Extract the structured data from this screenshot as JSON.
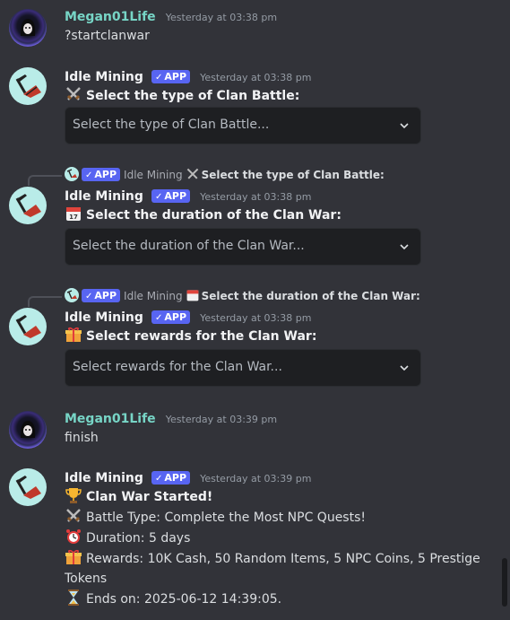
{
  "messages": [
    {
      "username": "Megan01Life",
      "timestamp": "Yesterday at 03:38 pm",
      "text": "?startclanwar"
    },
    {
      "username": "Idle Mining",
      "badge": "APP",
      "timestamp": "Yesterday at 03:38 pm",
      "heading": "Select the type of Clan Battle:",
      "select_placeholder": "Select the type of Clan Battle..."
    },
    {
      "reply": {
        "username": "Idle Mining",
        "badge": "APP",
        "text": "Select the type of Clan Battle:"
      },
      "username": "Idle Mining",
      "badge": "APP",
      "timestamp": "Yesterday at 03:38 pm",
      "heading": "Select the duration of the Clan War:",
      "select_placeholder": "Select the duration of the Clan War..."
    },
    {
      "reply": {
        "username": "Idle Mining",
        "badge": "APP",
        "text": "Select the duration of the Clan War:"
      },
      "username": "Idle Mining",
      "badge": "APP",
      "timestamp": "Yesterday at 03:38 pm",
      "heading": "Select rewards for the Clan War:",
      "select_placeholder": "Select rewards for the Clan War..."
    },
    {
      "username": "Megan01Life",
      "timestamp": "Yesterday at 03:39 pm",
      "text": "finish"
    },
    {
      "username": "Idle Mining",
      "badge": "APP",
      "timestamp": "Yesterday at 03:39 pm",
      "heading": "Clan War Started!",
      "lines": [
        "Battle Type: Complete the Most NPC Quests!",
        "Duration: 5 days",
        "Rewards: 10K Cash, 50 Random Items, 5 NPC Coins, 5 Prestige",
        "Tokens",
        "Ends on: 2025-06-12 14:39:05."
      ]
    }
  ],
  "icons": {
    "swords": "crossed-swords",
    "calendar": "calendar",
    "gift": "gift",
    "trophy": "trophy",
    "clock": "alarm-clock",
    "hourglass": "hourglass",
    "chevron": "chevron-down"
  },
  "colors": {
    "background": "#323339",
    "user_name": "#77d5c6",
    "app_badge": "#5865f2",
    "select_bg": "#1e1f22"
  }
}
